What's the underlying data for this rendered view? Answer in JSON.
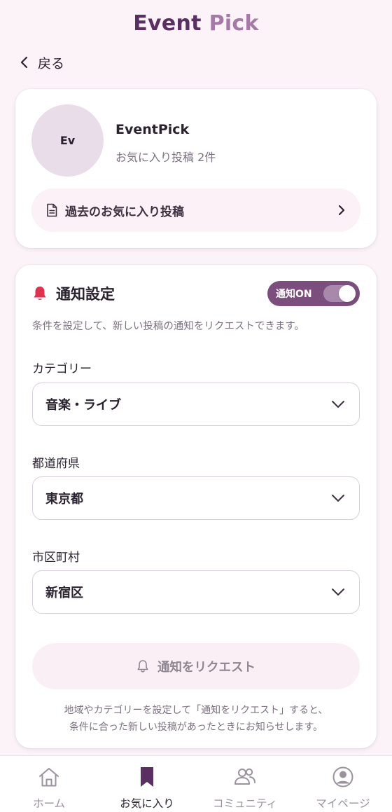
{
  "header": {
    "title_part1": "Event",
    "title_part2": "Pick",
    "back_label": "戻る"
  },
  "profile": {
    "avatar_initials": "Ev",
    "name": "EventPick",
    "subtitle": "お気に入り投稿 2件",
    "past_link_label": "過去のお気に入り投稿"
  },
  "notify": {
    "title": "通知設定",
    "toggle_label": "通知ON",
    "toggle_on": true,
    "description": "条件を設定して、新しい投稿の通知をリクエストできます。",
    "fields": {
      "category": {
        "label": "カテゴリー",
        "value": "音楽・ライブ"
      },
      "prefecture": {
        "label": "都道府県",
        "value": "東京都"
      },
      "city": {
        "label": "市区町村",
        "value": "新宿区"
      }
    },
    "request_button_label": "通知をリクエスト",
    "note_line1": "地域やカテゴリーを設定して「通知をリクエスト」すると、",
    "note_line2": "条件に合った新しい投稿があったときにお知らせします。"
  },
  "nav": {
    "items": [
      {
        "label": "ホーム",
        "icon": "home-icon"
      },
      {
        "label": "お気に入り",
        "icon": "bookmark-icon",
        "active": true
      },
      {
        "label": "コミュニティ",
        "icon": "people-icon"
      },
      {
        "label": "マイページ",
        "icon": "user-circle-icon"
      }
    ]
  },
  "colors": {
    "background": "#fbf3f7",
    "accent": "#7b4e7e",
    "title_dark": "#5a2f62",
    "title_light": "#a67aa6",
    "bell": "#e0314f"
  }
}
